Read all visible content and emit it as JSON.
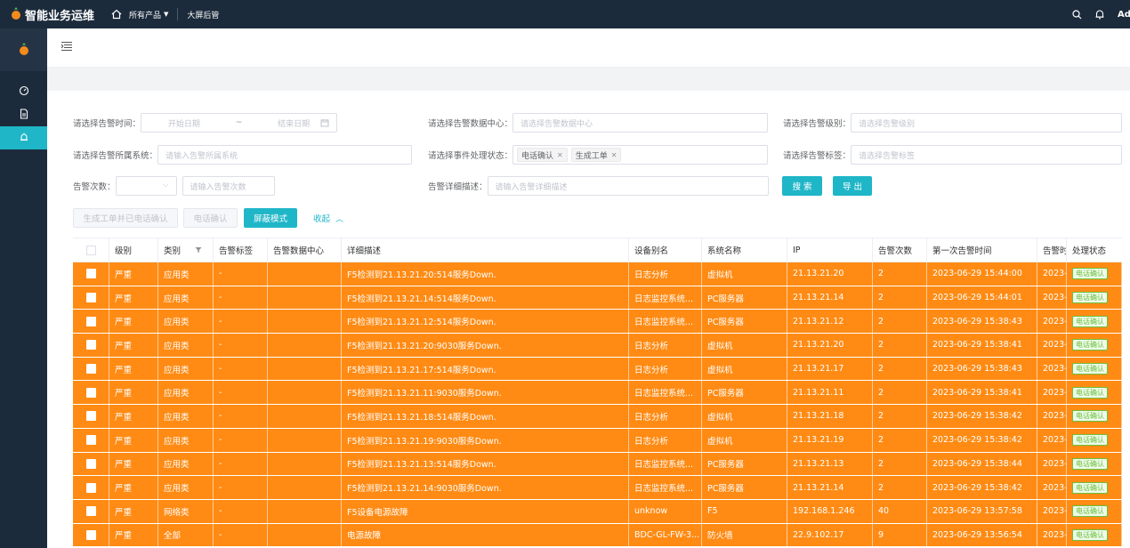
{
  "app": {
    "title": "智能业务运维",
    "user": "Ad"
  },
  "topnav": {
    "products": "所有产品",
    "screen": "大屏后管"
  },
  "filters": {
    "time_label": "请选择告警时间：",
    "start_placeholder": "开始日期",
    "range_sep": "~",
    "end_placeholder": "结束日期",
    "datacenter_label": "请选择告警数据中心：",
    "datacenter_placeholder": "请选择告警数据中心",
    "level_label": "请选择告警级别：",
    "level_placeholder": "请选择告警级别",
    "system_label": "请选择告警所属系统：",
    "system_placeholder": "请输入告警所属系统",
    "status_label": "请选择事件处理状态：",
    "status_tags": [
      "电话确认",
      "生成工单"
    ],
    "tag_label": "请选择告警标签：",
    "tag_placeholder": "请选择告警标签",
    "count_label": "告警次数：",
    "count_placeholder": "请输入告警次数",
    "detail_label": "告警详细描述：",
    "detail_placeholder": "请输入告警详细描述"
  },
  "buttons": {
    "search": "搜 索",
    "export": "导 出",
    "gen_ticket": "生成工单并已电话确认",
    "phone_confirm": "电话确认",
    "mask_mode": "屏蔽模式",
    "collapse": "收起"
  },
  "table": {
    "columns": [
      "级别",
      "类别",
      "告警标签",
      "告警数据中心",
      "详细描述",
      "设备别名",
      "系统名称",
      "IP",
      "告警次数",
      "第一次告警时间",
      "告警时",
      "处理状态"
    ],
    "rows": [
      [
        "严重",
        "应用类",
        "-",
        "",
        "F5检测到21.13.21.20:514服务Down.",
        "日志分析",
        "虚拟机",
        "21.13.21.20",
        "2",
        "2023-06-29 15:44:00",
        "2023-",
        "电话确认"
      ],
      [
        "严重",
        "应用类",
        "-",
        "",
        "F5检测到21.13.21.14:514服务Down.",
        "日志监控系统...",
        "PC服务器",
        "21.13.21.14",
        "2",
        "2023-06-29 15:44:01",
        "2023-",
        "电话确认"
      ],
      [
        "严重",
        "应用类",
        "-",
        "",
        "F5检测到21.13.21.12:514服务Down.",
        "日志监控系统...",
        "PC服务器",
        "21.13.21.12",
        "2",
        "2023-06-29 15:38:43",
        "2023-",
        "电话确认"
      ],
      [
        "严重",
        "应用类",
        "-",
        "",
        "F5检测到21.13.21.20:9030服务Down.",
        "日志分析",
        "虚拟机",
        "21.13.21.20",
        "2",
        "2023-06-29 15:38:41",
        "2023-",
        "电话确认"
      ],
      [
        "严重",
        "应用类",
        "-",
        "",
        "F5检测到21.13.21.17:514服务Down.",
        "日志分析",
        "虚拟机",
        "21.13.21.17",
        "2",
        "2023-06-29 15:38:43",
        "2023-",
        "电话确认"
      ],
      [
        "严重",
        "应用类",
        "-",
        "",
        "F5检测到21.13.21.11:9030服务Down.",
        "日志监控系统...",
        "PC服务器",
        "21.13.21.11",
        "2",
        "2023-06-29 15:38:41",
        "2023-",
        "电话确认"
      ],
      [
        "严重",
        "应用类",
        "-",
        "",
        "F5检测到21.13.21.18:514服务Down.",
        "日志分析",
        "虚拟机",
        "21.13.21.18",
        "2",
        "2023-06-29 15:38:42",
        "2023-",
        "电话确认"
      ],
      [
        "严重",
        "应用类",
        "-",
        "",
        "F5检测到21.13.21.19:9030服务Down.",
        "日志分析",
        "虚拟机",
        "21.13.21.19",
        "2",
        "2023-06-29 15:38:42",
        "2023-",
        "电话确认"
      ],
      [
        "严重",
        "应用类",
        "-",
        "",
        "F5检测到21.13.21.13:514服务Down.",
        "日志监控系统...",
        "PC服务器",
        "21.13.21.13",
        "2",
        "2023-06-29 15:38:44",
        "2023-",
        "电话确认"
      ],
      [
        "严重",
        "应用类",
        "-",
        "",
        "F5检测到21.13.21.14:9030服务Down.",
        "日志监控系统...",
        "PC服务器",
        "21.13.21.14",
        "2",
        "2023-06-29 15:38:42",
        "2023-",
        "电话确认"
      ],
      [
        "严重",
        "网络类",
        "-",
        "",
        "F5设备电源故障",
        "unknow",
        "F5",
        "192.168.1.246",
        "40",
        "2023-06-29 13:57:58",
        "2023-",
        "电话确认"
      ],
      [
        "严重",
        "全部",
        "-",
        "",
        "电源故障",
        "BDC-GL-FW-3...",
        "防火墙",
        "22.9.102.17",
        "9",
        "2023-06-29 13:56:54",
        "2023-",
        "电话确认"
      ]
    ]
  },
  "colors": {
    "accent": "#1fb6c8",
    "row_alarm": "#ff8b14",
    "header_bg": "#1c2b3c",
    "status_green": "#67c23a"
  },
  "icons": [
    "logo-icon",
    "home-icon",
    "search-icon",
    "bell-icon",
    "dashboard-icon",
    "document-icon",
    "alarm-icon",
    "menu-fold-icon",
    "calendar-icon",
    "filter-icon"
  ]
}
